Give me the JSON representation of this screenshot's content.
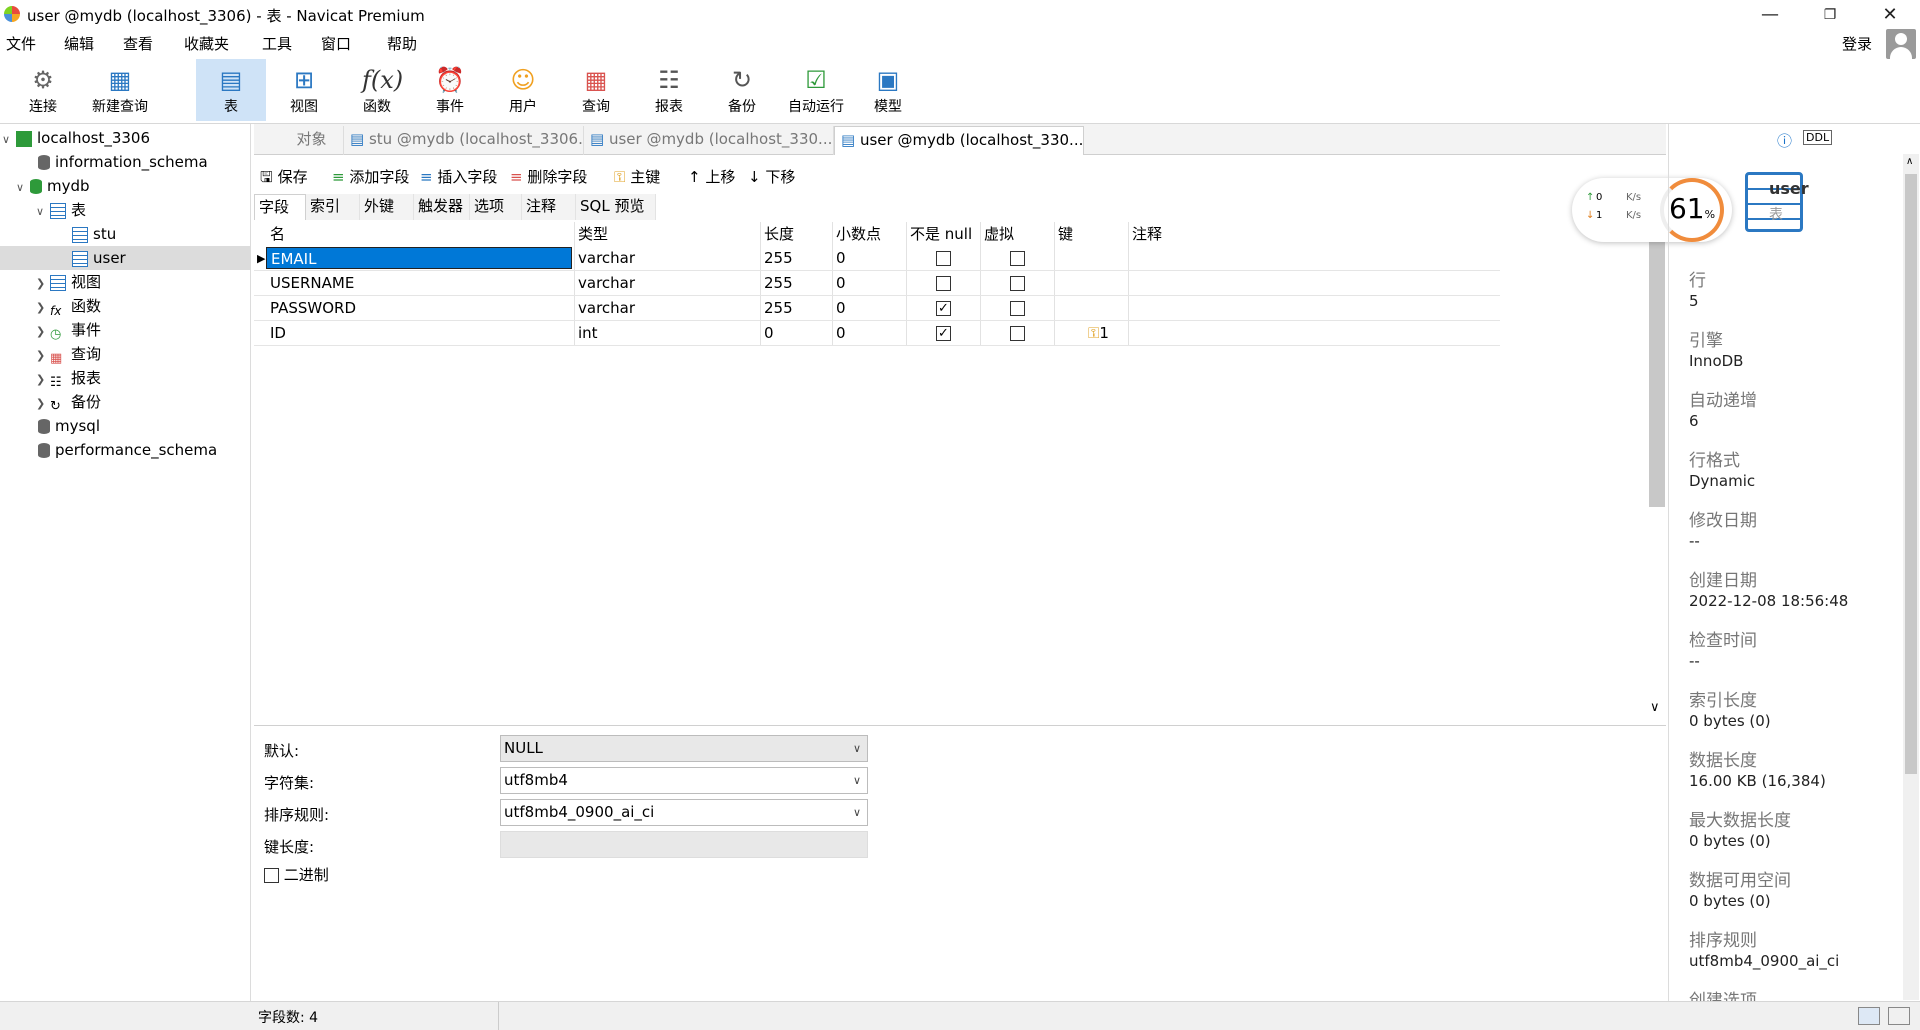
{
  "window": {
    "title": "user @mydb (localhost_3306) - 表 - Navicat Premium",
    "min_icon": "minimize-icon",
    "max_icon": "restore-icon",
    "close_icon": "close-icon"
  },
  "menu": [
    "文件",
    "编辑",
    "查看",
    "收藏夹",
    "工具",
    "窗口",
    "帮助"
  ],
  "login": "登录",
  "toolbar": [
    {
      "label": "连接",
      "icon": "plug-icon"
    },
    {
      "label": "新建查询",
      "icon": "new-query-icon"
    },
    {
      "label": "表",
      "icon": "table-icon"
    },
    {
      "label": "视图",
      "icon": "view-icon"
    },
    {
      "label": "函数",
      "icon": "function-icon"
    },
    {
      "label": "事件",
      "icon": "clock-icon"
    },
    {
      "label": "用户",
      "icon": "user-icon"
    },
    {
      "label": "查询",
      "icon": "query-icon"
    },
    {
      "label": "报表",
      "icon": "report-icon"
    },
    {
      "label": "备份",
      "icon": "backup-icon"
    },
    {
      "label": "自动运行",
      "icon": "schedule-icon"
    },
    {
      "label": "模型",
      "icon": "model-icon"
    }
  ],
  "tree": [
    {
      "label": "localhost_3306"
    },
    {
      "label": "information_schema"
    },
    {
      "label": "mydb"
    },
    {
      "label": "表"
    },
    {
      "label": "stu"
    },
    {
      "label": "user"
    },
    {
      "label": "视图"
    },
    {
      "label": "函数"
    },
    {
      "label": "事件"
    },
    {
      "label": "查询"
    },
    {
      "label": "报表"
    },
    {
      "label": "备份"
    },
    {
      "label": "mysql"
    },
    {
      "label": "performance_schema"
    }
  ],
  "tabs": [
    "对象",
    "stu @mydb (localhost_3306...",
    "user @mydb (localhost_330...",
    "user @mydb (localhost_330..."
  ],
  "actions": [
    "保存",
    "添加字段",
    "插入字段",
    "删除字段",
    "主键",
    "上移",
    "下移"
  ],
  "subtabs": [
    "字段",
    "索引",
    "外键",
    "触发器",
    "选项",
    "注释",
    "SQL 预览"
  ],
  "columns": [
    "名",
    "类型",
    "长度",
    "小数点",
    "不是 null",
    "虚拟",
    "键",
    "注释"
  ],
  "rows": [
    {
      "name": "EMAIL",
      "type": "varchar",
      "length": "255",
      "decimals": "0",
      "not_null": false,
      "virtual": false,
      "key": ""
    },
    {
      "name": "USERNAME",
      "type": "varchar",
      "length": "255",
      "decimals": "0",
      "not_null": false,
      "virtual": false,
      "key": ""
    },
    {
      "name": "PASSWORD",
      "type": "varchar",
      "length": "255",
      "decimals": "0",
      "not_null": true,
      "virtual": false,
      "key": ""
    },
    {
      "name": "ID",
      "type": "int",
      "length": "0",
      "decimals": "0",
      "not_null": true,
      "virtual": false,
      "key": "1"
    }
  ],
  "bottom": {
    "default_label": "默认:",
    "default_value": "NULL",
    "charset_label": "字符集:",
    "charset_value": "utf8mb4",
    "collation_label": "排序规则:",
    "collation_value": "utf8mb4_0900_ai_ci",
    "keylen_label": "键长度:",
    "binary_label": "二进制"
  },
  "status": "字段数: 4",
  "network": {
    "up": "0",
    "down": "1",
    "unit": "K/s",
    "percent": "61",
    "pct_sign": "%"
  },
  "info": {
    "name": "user",
    "kind": "表",
    "fields": [
      {
        "label": "行",
        "value": "5"
      },
      {
        "label": "引擎",
        "value": "InnoDB"
      },
      {
        "label": "自动递增",
        "value": "6"
      },
      {
        "label": "行格式",
        "value": "Dynamic"
      },
      {
        "label": "修改日期",
        "value": "--"
      },
      {
        "label": "创建日期",
        "value": "2022-12-08 18:56:48"
      },
      {
        "label": "检查时间",
        "value": "--"
      },
      {
        "label": "索引长度",
        "value": "0 bytes (0)"
      },
      {
        "label": "数据长度",
        "value": "16.00 KB (16,384)"
      },
      {
        "label": "最大数据长度",
        "value": "0 bytes (0)"
      },
      {
        "label": "数据可用空间",
        "value": "0 bytes (0)"
      },
      {
        "label": "排序规则",
        "value": "utf8mb4_0900_ai_ci"
      },
      {
        "label": "创建选项",
        "value": ""
      }
    ]
  },
  "colors": {
    "accent": "#0078d7",
    "selected_cell": "#0078d7",
    "ring": "#f08c3c"
  }
}
